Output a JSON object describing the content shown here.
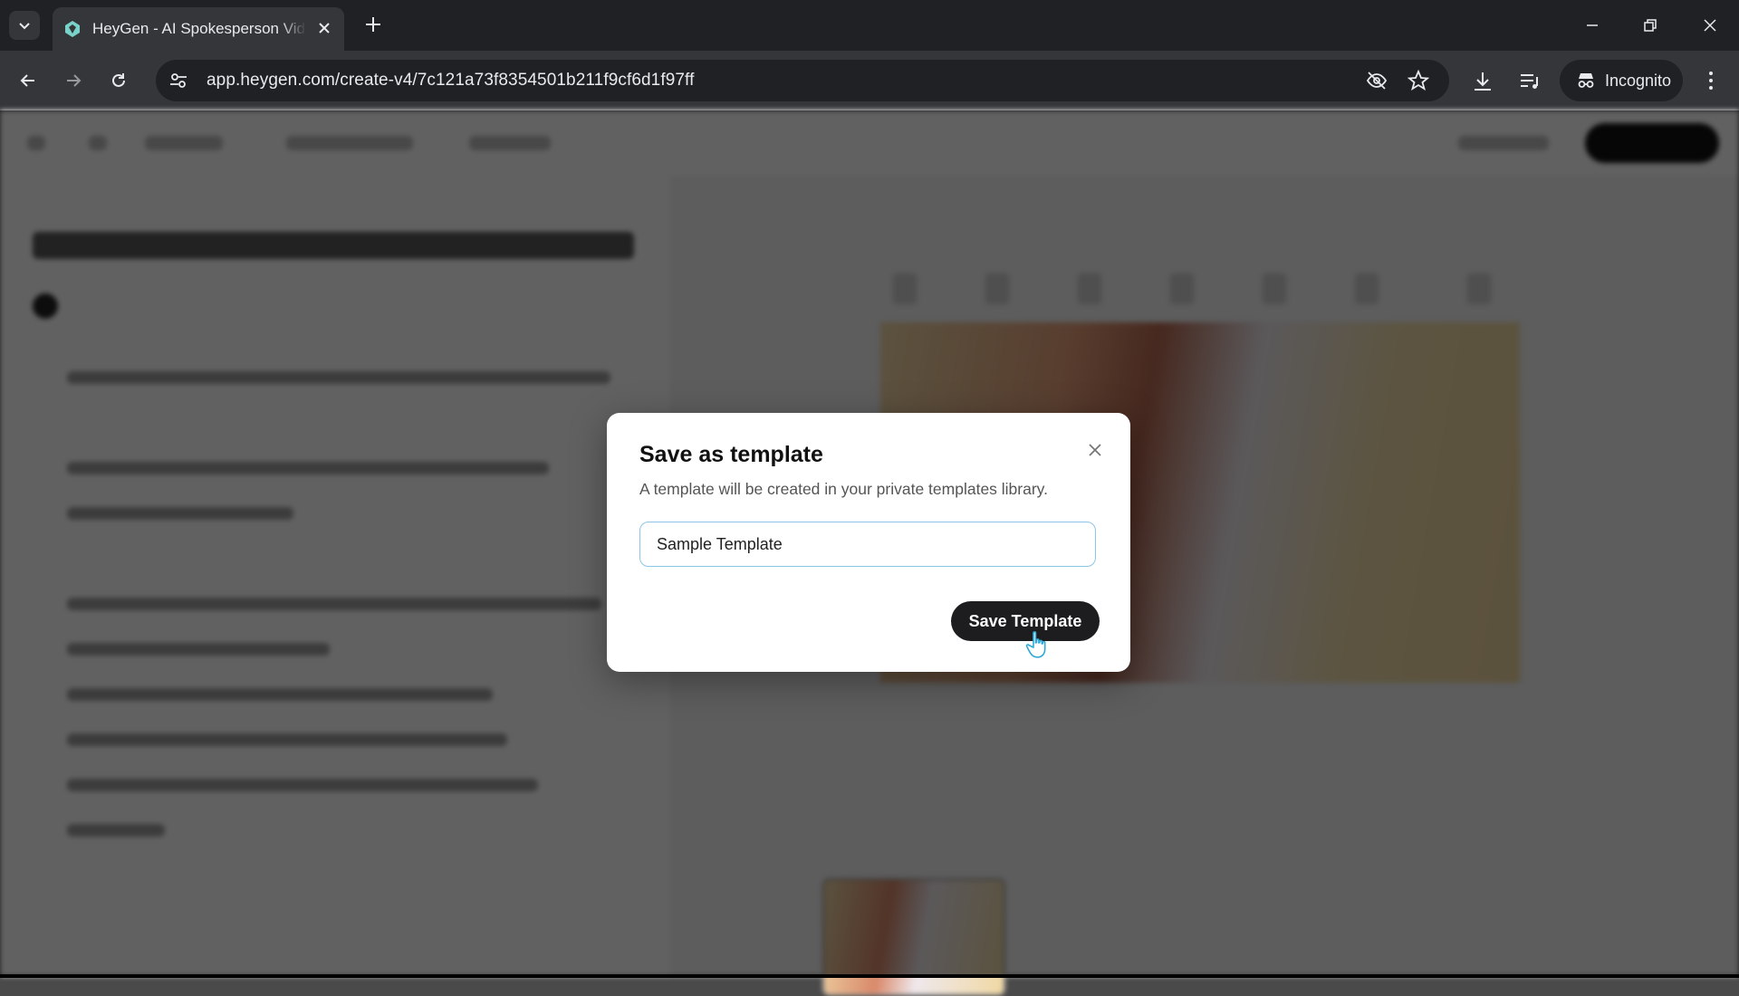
{
  "browser": {
    "tab_title": "HeyGen - AI Spokesperson Video",
    "url": "app.heygen.com/create-v4/7c121a73f8354501b211f9cf6d1f97ff",
    "profile_label": "Incognito",
    "icons": {
      "tab_search": "chevron-down-icon",
      "new_tab": "plus-icon",
      "back": "arrow-left-icon",
      "forward": "arrow-right-icon",
      "reload": "reload-icon",
      "site_info": "tune-icon",
      "eye_off": "eye-off-icon",
      "bookmark": "star-icon",
      "download": "download-icon",
      "media": "media-control-icon",
      "incognito": "incognito-icon",
      "menu": "kebab-icon"
    }
  },
  "dialog": {
    "title": "Save as template",
    "description": "A template will be created in your private templates library.",
    "input_value": "Sample Template",
    "save_label": "Save Template"
  },
  "colors": {
    "overlay": "#000000",
    "primary_button": "#1d1d1f",
    "input_focus": "#8ec4e8",
    "cursor": "#2fa8d9"
  }
}
